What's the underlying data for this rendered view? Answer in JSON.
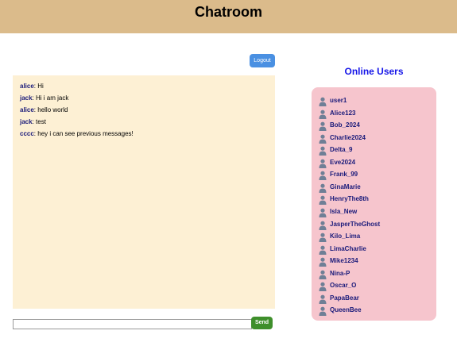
{
  "header": {
    "title": "Chatroom"
  },
  "logout_label": "Logout",
  "messages": [
    {
      "user": "alice",
      "text": ": Hi"
    },
    {
      "user": "jack",
      "text": ": Hi i am jack"
    },
    {
      "user": "alice",
      "text": ": hello world"
    },
    {
      "user": "jack",
      "text": ": test"
    },
    {
      "user": "cccc",
      "text": ": hey i can see previous messages!"
    }
  ],
  "input": {
    "value": "",
    "placeholder": ""
  },
  "send_label": "Send",
  "online": {
    "title": "Online Users",
    "icon": "user-icon",
    "users": [
      "user1",
      "Alice123",
      "Bob_2024",
      "Charlie2024",
      "Delta_9",
      "Eve2024",
      "Frank_99",
      "GinaMarie",
      "HenryThe8th",
      "Isla_New",
      "JasperTheGhost",
      "Kilo_Lima",
      "LimaCharlie",
      "Mike1234",
      "Nina-P",
      "Oscar_O",
      "PapaBear",
      "QueenBee"
    ]
  },
  "colors": {
    "header_bg": "#dbbb8b",
    "chat_bg": "#fdf0d4",
    "users_bg": "#f6c5cd",
    "logout_bg": "#4a90e2",
    "send_bg": "#3e8f2b",
    "online_title": "#1515e8",
    "username": "#1a1a7a"
  }
}
